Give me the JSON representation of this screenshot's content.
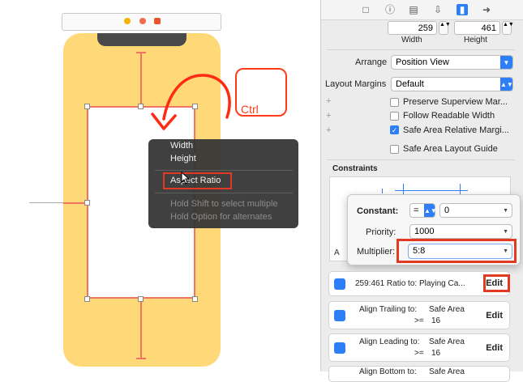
{
  "canvas": {
    "menu": {
      "items": [
        "Width",
        "Height",
        "Aspect Ratio"
      ],
      "hints": [
        "Hold Shift to select multiple",
        "Hold Option for alternates"
      ]
    },
    "ctrl_label": "Ctrl"
  },
  "inspector": {
    "size": {
      "width_value": "259",
      "height_value": "461",
      "width_label": "Width",
      "height_label": "Height"
    },
    "arrange": {
      "label": "Arrange",
      "value": "Position View"
    },
    "layout_margins": {
      "label": "Layout Margins",
      "value": "Default"
    },
    "checkboxes": [
      {
        "label": "Preserve Superview Mar...",
        "checked": false
      },
      {
        "label": "Follow Readable Width",
        "checked": false
      },
      {
        "label": "Safe Area Relative Margi...",
        "checked": true
      },
      {
        "label": "Safe Area Layout Guide",
        "checked": false
      }
    ],
    "constraints_heading": "Constraints",
    "popover": {
      "constant_label": "Constant:",
      "relation": "=",
      "constant_value": "0",
      "priority_label": "Priority:",
      "priority_value": "1000",
      "multiplier_label": "Multiplier:",
      "multiplier_value": "5:8"
    },
    "constraint_cards": [
      {
        "text": "259:461 Ratio to:  Playing Ca...",
        "edit": "Edit"
      },
      {
        "text": "Align Trailing to:",
        "target": "Safe Area",
        "op": ">=",
        "value": "16",
        "edit": "Edit"
      },
      {
        "text": "Align Leading to:",
        "target": "Safe Area",
        "op": ">=",
        "value": "16",
        "edit": "Edit"
      },
      {
        "text": "Align Bottom to:",
        "target": "Safe Area"
      }
    ],
    "partial_letter": "A"
  },
  "colors": {
    "accent": "#2d7ef7",
    "highlight": "#e23a22",
    "phone": "#ffd978",
    "constraint": "#ef7562"
  }
}
